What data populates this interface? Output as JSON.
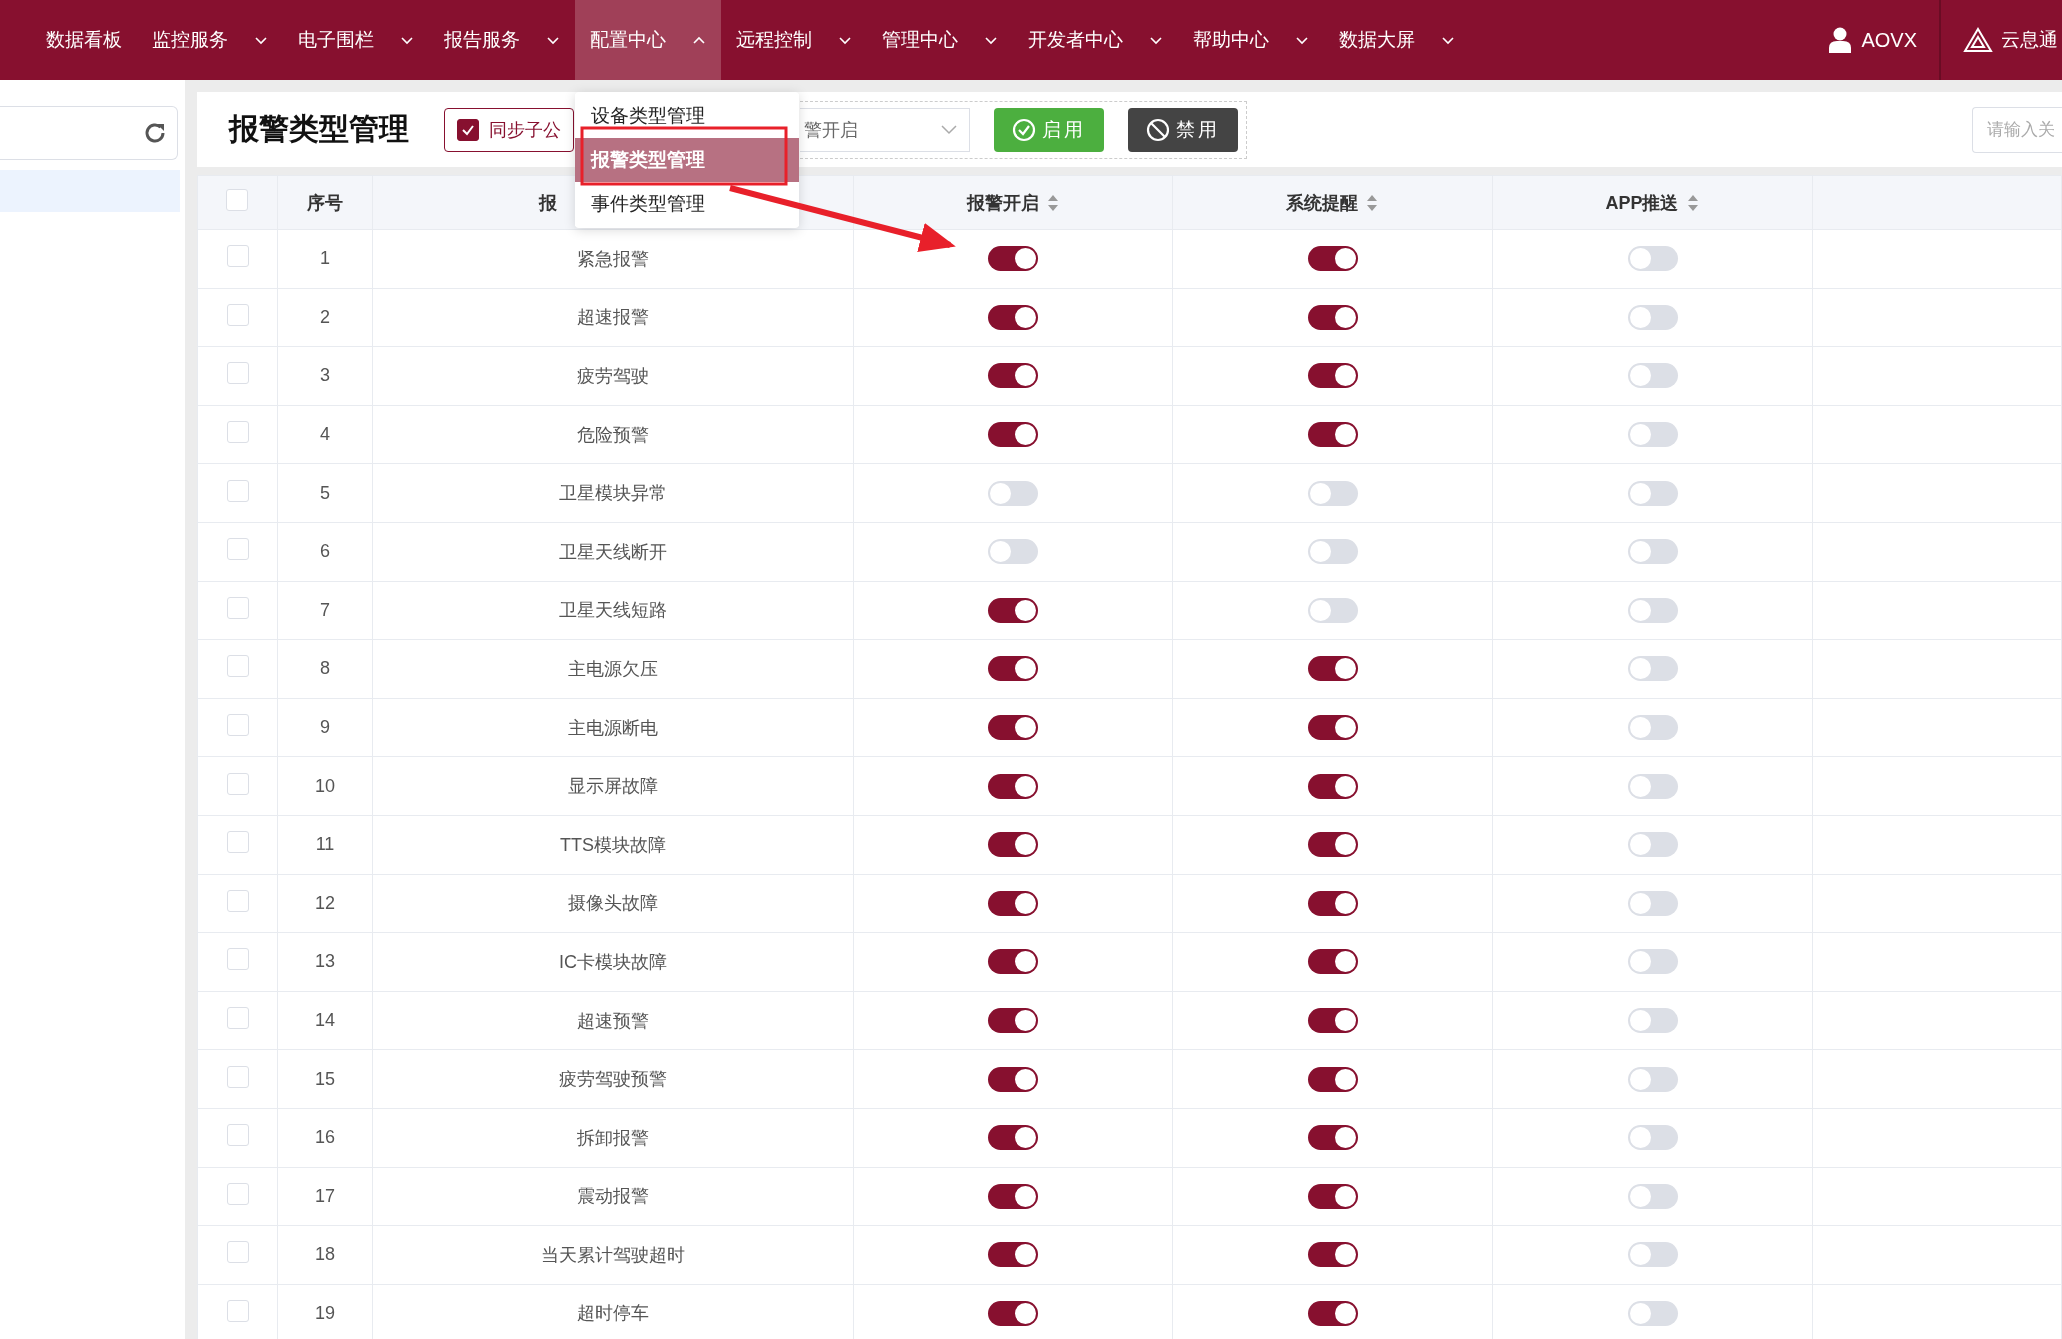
{
  "nav": {
    "items": [
      {
        "label": "数据看板",
        "has_menu": false,
        "expanded": false
      },
      {
        "label": "监控服务",
        "has_menu": true,
        "expanded": false
      },
      {
        "label": "电子围栏",
        "has_menu": true,
        "expanded": false
      },
      {
        "label": "报告服务",
        "has_menu": true,
        "expanded": false
      },
      {
        "label": "配置中心",
        "has_menu": true,
        "expanded": true,
        "menu": [
          {
            "label": "设备类型管理",
            "selected": false
          },
          {
            "label": "报警类型管理",
            "selected": true
          },
          {
            "label": "事件类型管理",
            "selected": false
          }
        ]
      },
      {
        "label": "远程控制",
        "has_menu": true,
        "expanded": false
      },
      {
        "label": "管理中心",
        "has_menu": true,
        "expanded": false
      },
      {
        "label": "开发者中心",
        "has_menu": true,
        "expanded": false
      },
      {
        "label": "帮助中心",
        "has_menu": true,
        "expanded": false
      },
      {
        "label": "数据大屏",
        "has_menu": true,
        "expanded": false
      }
    ],
    "user": "AOVX",
    "brand": "云息通"
  },
  "page": {
    "title": "报警类型管理",
    "sync_checkbox": {
      "label": "同步子公",
      "checked": true
    },
    "filter_select": {
      "value": "警开启"
    },
    "buttons": [
      {
        "label": "启用",
        "kind": "enable"
      },
      {
        "label": "禁用",
        "kind": "disable"
      }
    ],
    "search": {
      "placeholder": "请输入关"
    }
  },
  "table": {
    "header_checkbox": {
      "checked": false
    },
    "columns": [
      {
        "label": "序号",
        "sortable": false
      },
      {
        "label": "报",
        "sortable": false
      },
      {
        "label": "报警开启",
        "sortable": true
      },
      {
        "label": "系统提醒",
        "sortable": true
      },
      {
        "label": "APP推送",
        "sortable": true
      }
    ],
    "rows": [
      {
        "index": "1",
        "name": "紧急报警",
        "selected": false,
        "alarm_on": true,
        "system_notify": true,
        "app_push": false
      },
      {
        "index": "2",
        "name": "超速报警",
        "selected": false,
        "alarm_on": true,
        "system_notify": true,
        "app_push": false
      },
      {
        "index": "3",
        "name": "疲劳驾驶",
        "selected": false,
        "alarm_on": true,
        "system_notify": true,
        "app_push": false
      },
      {
        "index": "4",
        "name": "危险预警",
        "selected": false,
        "alarm_on": true,
        "system_notify": true,
        "app_push": false
      },
      {
        "index": "5",
        "name": "卫星模块异常",
        "selected": false,
        "alarm_on": false,
        "system_notify": false,
        "app_push": false
      },
      {
        "index": "6",
        "name": "卫星天线断开",
        "selected": false,
        "alarm_on": false,
        "system_notify": false,
        "app_push": false
      },
      {
        "index": "7",
        "name": "卫星天线短路",
        "selected": false,
        "alarm_on": true,
        "system_notify": false,
        "app_push": false
      },
      {
        "index": "8",
        "name": "主电源欠压",
        "selected": false,
        "alarm_on": true,
        "system_notify": true,
        "app_push": false
      },
      {
        "index": "9",
        "name": "主电源断电",
        "selected": false,
        "alarm_on": true,
        "system_notify": true,
        "app_push": false
      },
      {
        "index": "10",
        "name": "显示屏故障",
        "selected": false,
        "alarm_on": true,
        "system_notify": true,
        "app_push": false
      },
      {
        "index": "11",
        "name": "TTS模块故障",
        "selected": false,
        "alarm_on": true,
        "system_notify": true,
        "app_push": false
      },
      {
        "index": "12",
        "name": "摄像头故障",
        "selected": false,
        "alarm_on": true,
        "system_notify": true,
        "app_push": false
      },
      {
        "index": "13",
        "name": "IC卡模块故障",
        "selected": false,
        "alarm_on": true,
        "system_notify": true,
        "app_push": false
      },
      {
        "index": "14",
        "name": "超速预警",
        "selected": false,
        "alarm_on": true,
        "system_notify": true,
        "app_push": false
      },
      {
        "index": "15",
        "name": "疲劳驾驶预警",
        "selected": false,
        "alarm_on": true,
        "system_notify": true,
        "app_push": false
      },
      {
        "index": "16",
        "name": "拆卸报警",
        "selected": false,
        "alarm_on": true,
        "system_notify": true,
        "app_push": false
      },
      {
        "index": "17",
        "name": "震动报警",
        "selected": false,
        "alarm_on": true,
        "system_notify": true,
        "app_push": false
      },
      {
        "index": "18",
        "name": "当天累计驾驶超时",
        "selected": false,
        "alarm_on": true,
        "system_notify": true,
        "app_push": false
      },
      {
        "index": "19",
        "name": "超时停车",
        "selected": false,
        "alarm_on": true,
        "system_notify": true,
        "app_push": false
      }
    ]
  }
}
